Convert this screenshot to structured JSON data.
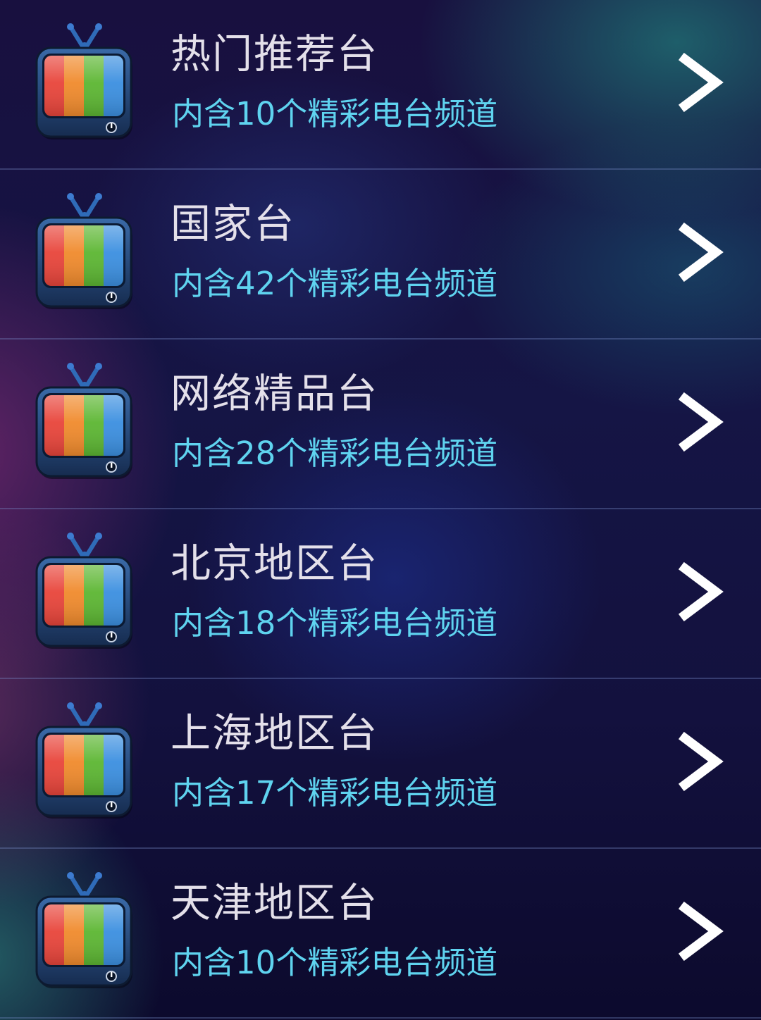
{
  "channel_list": [
    {
      "title": "热门推荐台",
      "subtitle": "内含10个精彩电台频道",
      "icon": "tv-icon",
      "action_icon": "chevron-right-icon"
    },
    {
      "title": "国家台",
      "subtitle": "内含42个精彩电台频道",
      "icon": "tv-icon",
      "action_icon": "chevron-right-icon"
    },
    {
      "title": "网络精品台",
      "subtitle": "内含28个精彩电台频道",
      "icon": "tv-icon",
      "action_icon": "chevron-right-icon"
    },
    {
      "title": "北京地区台",
      "subtitle": "内含18个精彩电台频道",
      "icon": "tv-icon",
      "action_icon": "chevron-right-icon"
    },
    {
      "title": "上海地区台",
      "subtitle": "内含17个精彩电台频道",
      "icon": "tv-icon",
      "action_icon": "chevron-right-icon"
    },
    {
      "title": "天津地区台",
      "subtitle": "内含10个精彩电台频道",
      "icon": "tv-icon",
      "action_icon": "chevron-right-icon"
    }
  ],
  "colors": {
    "title_text": "#e4e0ea",
    "subtitle_text": "#5fd3ef",
    "tv_stripes": [
      "#e8443a",
      "#f08a2c",
      "#5cb632",
      "#3b8fe0"
    ],
    "tv_body": "#1f3c66"
  }
}
